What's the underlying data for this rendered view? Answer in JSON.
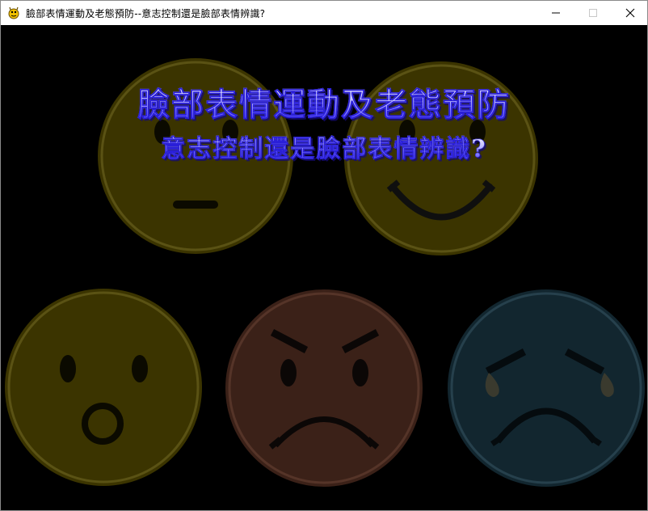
{
  "window": {
    "title": "臉部表情運動及老態預防--意志控制還是臉部表情辨識?",
    "icon": "pygame-snake-icon",
    "controls": [
      "minimize-icon",
      "maximize-icon",
      "close-icon"
    ]
  },
  "game": {
    "background": "#000000",
    "title_line1": "臉部表情運動及老態預防",
    "title_line2": "意志控制還是臉部表情辨識?",
    "title_colors": {
      "fill_top": "#ffffff",
      "fill_bottom": "#3c30ff",
      "outline": "#2a1fd8"
    },
    "faces": [
      {
        "expression": "neutral",
        "color": "#3b3400"
      },
      {
        "expression": "happy",
        "color": "#3b3400"
      },
      {
        "expression": "surprised",
        "color": "#3b3400"
      },
      {
        "expression": "angry",
        "color": "#3b2118"
      },
      {
        "expression": "sad",
        "color": "#12262f"
      }
    ]
  }
}
